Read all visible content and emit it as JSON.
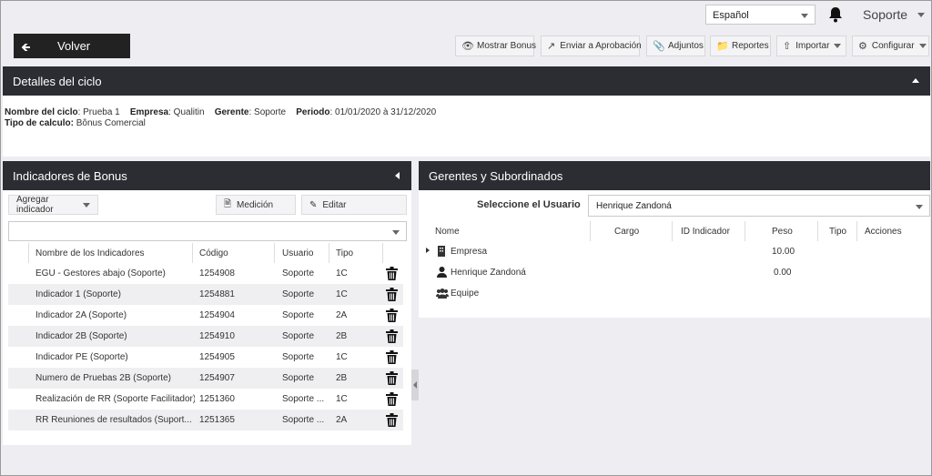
{
  "header": {
    "language": "Español",
    "user_name": "Soporte",
    "back_label": "Volver",
    "toolbar": [
      {
        "label": "Mostrar Bonus",
        "icon": "eye-icon"
      },
      {
        "label": "Enviar a Aprobación",
        "icon": "share-icon"
      },
      {
        "label": "Adjuntos",
        "icon": "paperclip-icon"
      },
      {
        "label": "Reportes",
        "icon": "folder-icon"
      },
      {
        "label": "Importar",
        "icon": "upload-icon"
      },
      {
        "label": "Configurar",
        "icon": "gear-icon"
      }
    ]
  },
  "details": {
    "title": "Detalles del ciclo",
    "cycle_name_label": "Nombre del ciclo",
    "cycle_name": ": Prueba 1",
    "company_label": "Empresa",
    "company": ": Qualitin",
    "manager_label": "Gerente",
    "manager": ": Soporte",
    "period_label": "Periodo",
    "period": ": 01/01/2020 à 31/12/2020",
    "calc_label": "Tipo de calculo:",
    "calc": "Bônus Comercial"
  },
  "indicators": {
    "title": "Indicadores de Bonus",
    "add_label": "Agregar indicador",
    "measure_label": "Medición",
    "edit_label": "Editar",
    "columns": [
      "Nombre de los Indicadores",
      "Código",
      "Usuario",
      "Tipo"
    ],
    "rows": [
      [
        "EGU - Gestores abajo (Soporte)",
        "1254908",
        "Soporte",
        "1C"
      ],
      [
        "Indicador 1 (Soporte)",
        "1254881",
        "Soporte",
        "1C"
      ],
      [
        "Indicador 2A (Soporte)",
        "1254904",
        "Soporte",
        "2A"
      ],
      [
        "Indicador 2B (Soporte)",
        "1254910",
        "Soporte",
        "2B"
      ],
      [
        "Indicador PE (Soporte)",
        "1254905",
        "Soporte",
        "1C"
      ],
      [
        "Numero de Pruebas 2B (Soporte)",
        "1254907",
        "Soporte",
        "2B"
      ],
      [
        "Realización de RR (Soporte Facilitador)",
        "1251360",
        "Soporte ...",
        "1C"
      ],
      [
        "RR Reuniones de resultados (Suport...",
        "1251365",
        "Soporte ...",
        "2A"
      ]
    ]
  },
  "managers": {
    "title": "Gerentes y Subordinados",
    "select_label": "Seleccione el Usuario",
    "selected_user": "Henrique Zandoná",
    "columns": [
      "Nome",
      "Cargo",
      "ID Indicador",
      "Peso",
      "Tipo",
      "Acciones"
    ],
    "tree": [
      {
        "name": "Empresa",
        "icon": "building-icon",
        "peso": "10.00"
      },
      {
        "name": "Henrique Zandoná",
        "icon": "person-icon",
        "peso": "0.00"
      },
      {
        "name": "Equipe",
        "icon": "team-icon",
        "peso": ""
      }
    ]
  }
}
